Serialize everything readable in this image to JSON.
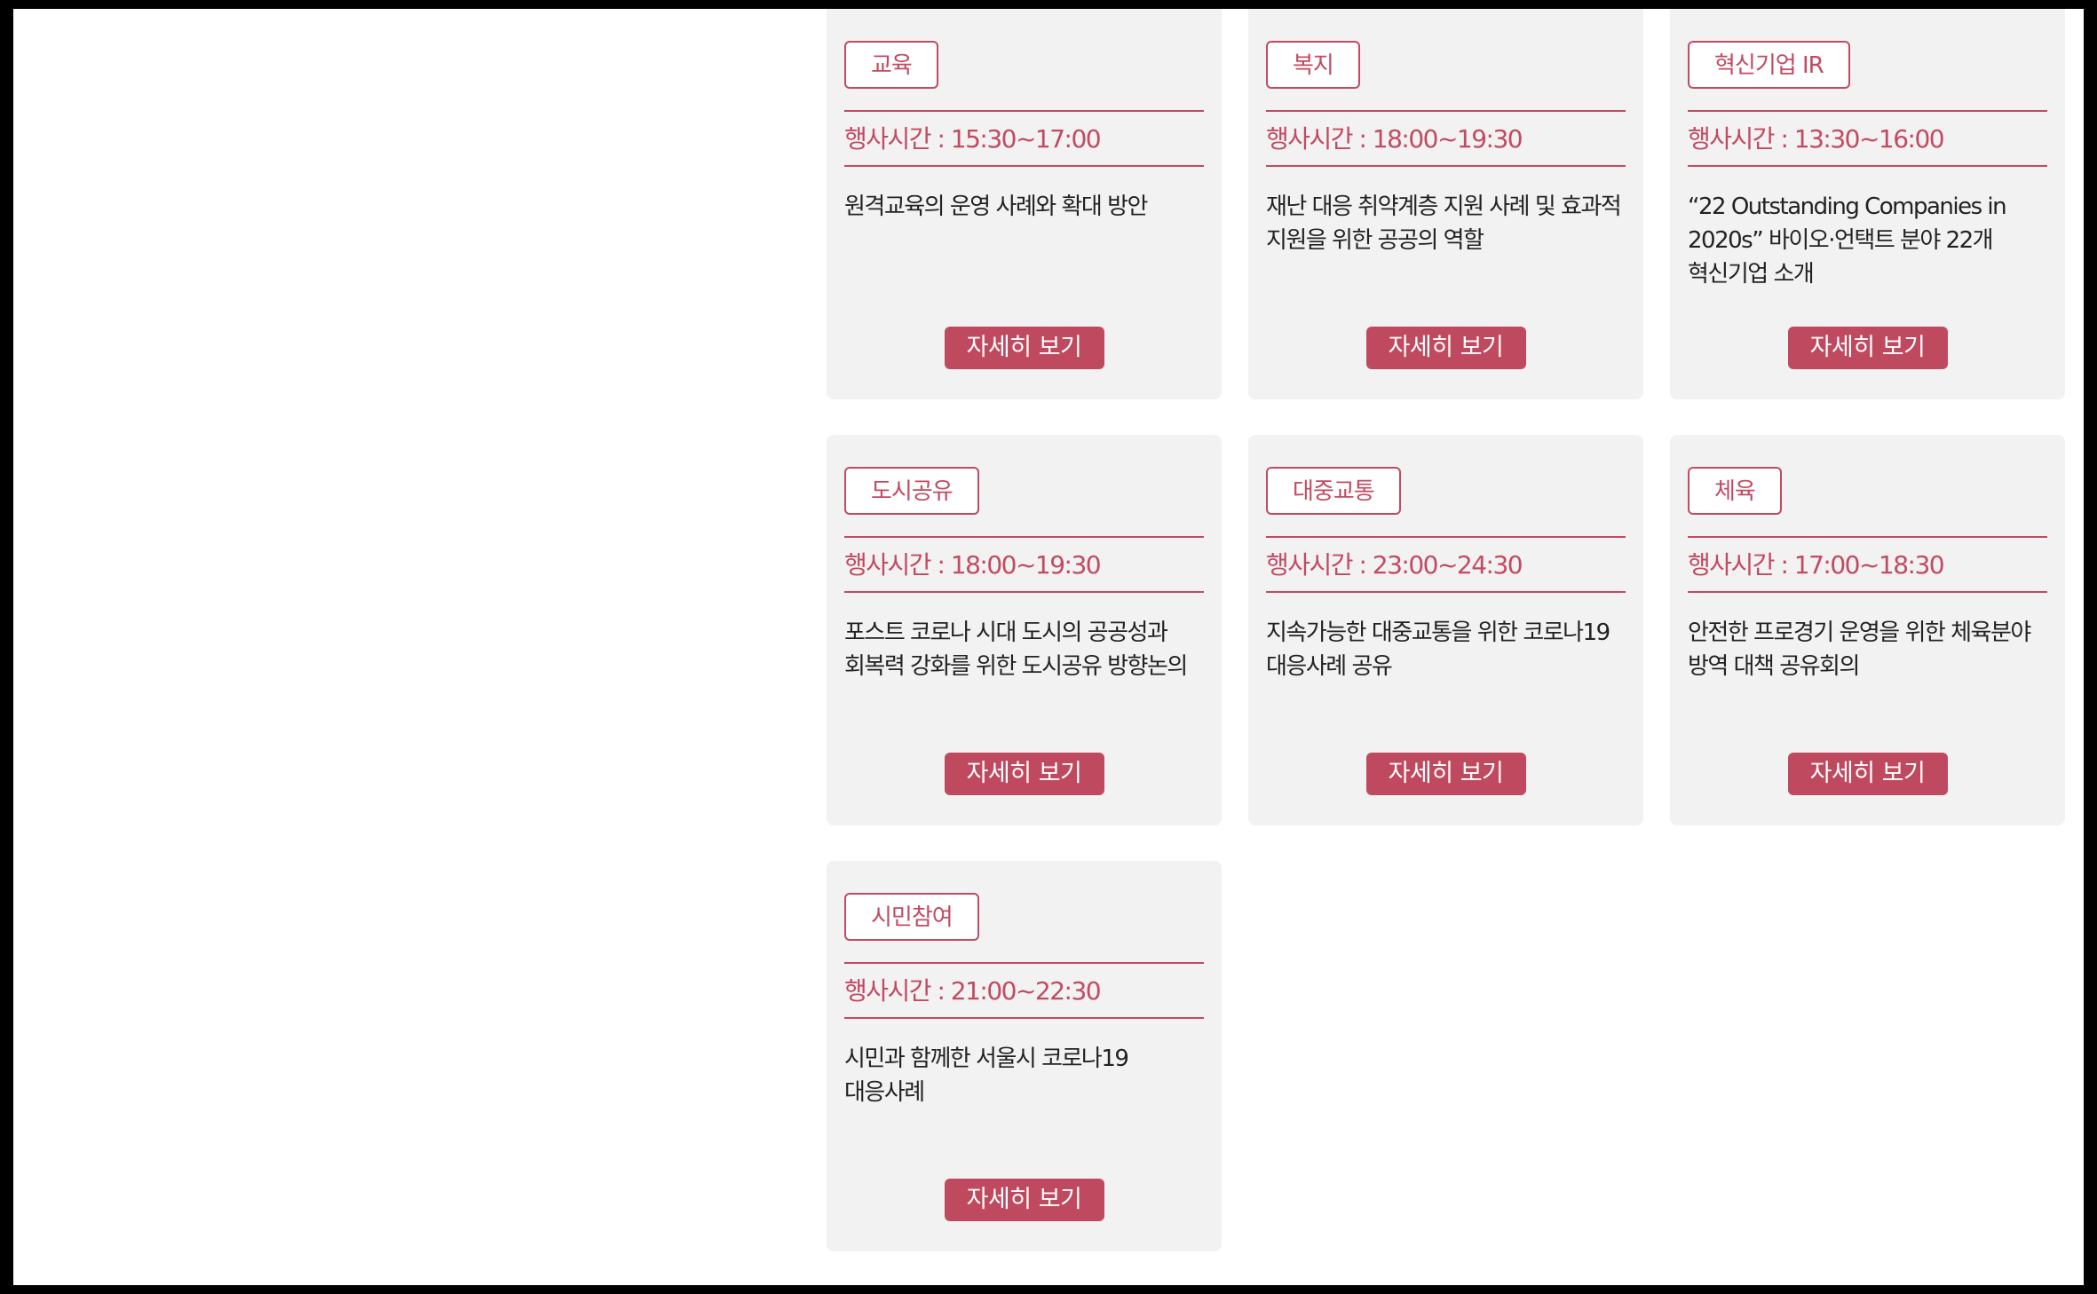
{
  "colors": {
    "accent": "#c24a61",
    "button": "#bf4a60",
    "card_background": "#f2f2f2",
    "text": "#222222"
  },
  "time_prefix": "행사시간 : ",
  "detail_label": "자세히 보기",
  "cards": [
    {
      "tag": "교육",
      "time": "행사시간 : 15:30~17:00",
      "description": "원격교육의 운영 사례와 확대 방안"
    },
    {
      "tag": "복지",
      "time": "행사시간 : 18:00~19:30",
      "description": "재난 대응 취약계층 지원 사례 및 효과적 지원을 위한 공공의 역할"
    },
    {
      "tag": "혁신기업 IR",
      "time": "행사시간 : 13:30~16:00",
      "description": "“22 Outstanding Companies in 2020s” 바이오·언택트 분야 22개 혁신기업 소개"
    },
    {
      "tag": "도시공유",
      "time": "행사시간 : 18:00~19:30",
      "description": "포스트 코로나 시대 도시의 공공성과 회복력 강화를 위한 도시공유 방향논의"
    },
    {
      "tag": "대중교통",
      "time": "행사시간 : 23:00~24:30",
      "description": "지속가능한 대중교통을 위한 코로나19 대응사례 공유"
    },
    {
      "tag": "체육",
      "time": "행사시간 : 17:00~18:30",
      "description": "안전한 프로경기 운영을 위한 체육분야 방역 대책 공유회의"
    },
    {
      "tag": "시민참여",
      "time": "행사시간 : 21:00~22:30",
      "description": "시민과 함께한 서울시 코로나19 대응사례"
    }
  ]
}
